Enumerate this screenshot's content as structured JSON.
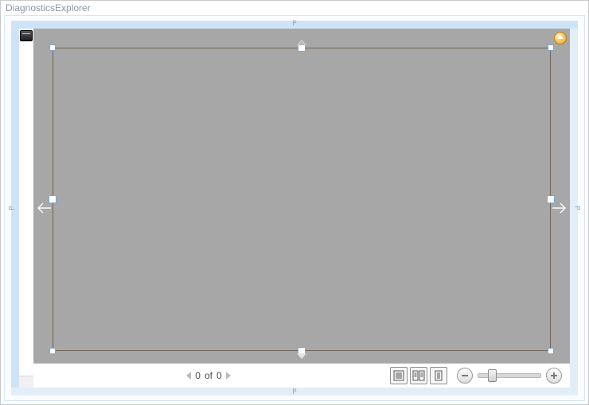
{
  "window": {
    "title": "DiagnosticsExplorer"
  },
  "ruler_label": "P",
  "pager": {
    "prev_enabled": false,
    "next_enabled": false,
    "current": 0,
    "sep": "of",
    "total": 0
  },
  "view_modes": {
    "whole_page_selected": true
  },
  "zoom": {
    "value_percent": 18
  },
  "icons": {
    "help": "help-arrow-up-icon",
    "collapse": "collapse-chip-icon"
  }
}
